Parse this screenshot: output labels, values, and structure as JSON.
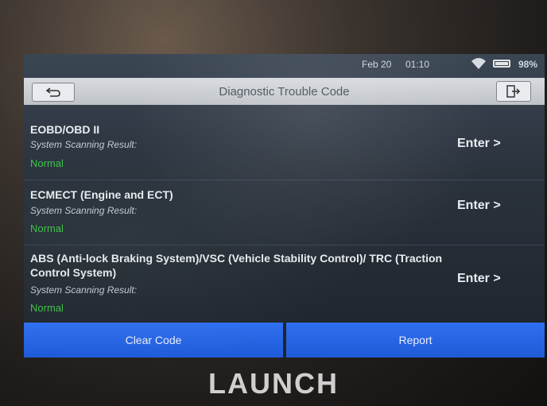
{
  "status_bar": {
    "date": "Feb 20",
    "time": "01:10",
    "battery": "98%"
  },
  "header": {
    "title": "Diagnostic Trouble Code",
    "back_icon": "back-arrow-icon",
    "exit_icon": "exit-icon"
  },
  "systems": [
    {
      "name": "EOBD/OBD II",
      "result_label": "System Scanning Result:",
      "result": "Normal",
      "action": "Enter >"
    },
    {
      "name": "ECMECT (Engine and ECT)",
      "result_label": "System Scanning Result:",
      "result": "Normal",
      "action": "Enter >"
    },
    {
      "name": "ABS (Anti-lock Braking System)/VSC (Vehicle Stability Control)/ TRC (Traction Control System)",
      "result_label": "System Scanning Result:",
      "result": "Normal",
      "action": "Enter >"
    }
  ],
  "bottom": {
    "clear_label": "Clear Code",
    "report_label": "Report"
  },
  "brand": "LAUNCH",
  "colors": {
    "accent": "#1f5bd8",
    "normal": "#3ec24a"
  }
}
